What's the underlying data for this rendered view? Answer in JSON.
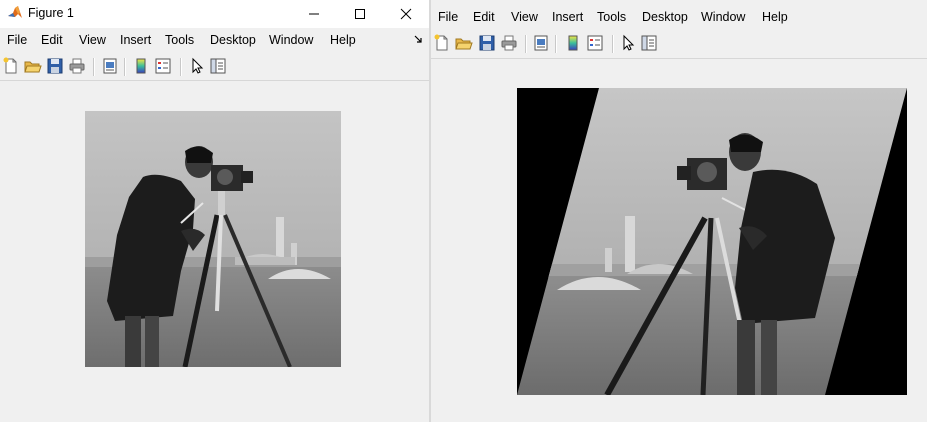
{
  "left_window": {
    "title": "Figure 1",
    "menu": [
      "File",
      "Edit",
      "View",
      "Insert",
      "Tools",
      "Desktop",
      "Window",
      "Help"
    ]
  },
  "right_window": {
    "menu": [
      "File",
      "Edit",
      "View",
      "Insert",
      "Tools",
      "Desktop",
      "Window",
      "Help"
    ]
  },
  "toolbar_icons": [
    "new-figure-icon",
    "open-folder-icon",
    "save-icon",
    "print-icon",
    "print-preview-icon",
    "colorbar-icon",
    "legend-icon",
    "pointer-icon",
    "property-inspector-icon"
  ],
  "colors": {
    "window_bg": "#f0f0f0",
    "titlebar_bg": "#ffffff",
    "image_border": "#000000"
  }
}
